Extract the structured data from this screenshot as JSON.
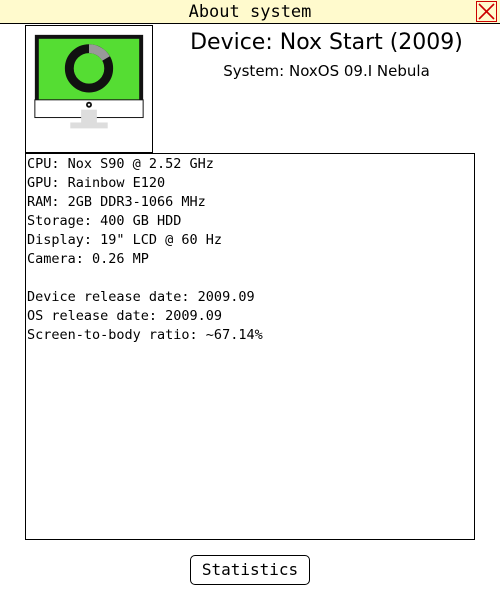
{
  "window": {
    "title": "About system",
    "close_icon": "close-icon"
  },
  "device": {
    "title": "Device: Nox Start (2009)",
    "system": "System: NoxOS 09.I Nebula",
    "image_icon": "computer-monitor-icon",
    "colors": {
      "screen_green": "#55dd33",
      "screen_frame": "#111111",
      "ring_dark": "#111111",
      "ring_segment": "#999999",
      "stand": "#dddddd"
    }
  },
  "specs": {
    "cpu": "CPU: Nox S90 @ 2.52 GHz",
    "gpu": "GPU: Rainbow E120",
    "ram": "RAM: 2GB DDR3-1066 MHz",
    "storage": "Storage: 400 GB HDD",
    "display": "Display: 19\" LCD @ 60 Hz",
    "camera": "Camera: 0.26 MP",
    "device_release": "Device release date: 2009.09",
    "os_release": "OS release date: 2009.09",
    "screen_ratio": "Screen-to-body ratio: ~67.14%"
  },
  "actions": {
    "statistics_label": "Statistics"
  },
  "colors": {
    "titlebar_bg": "#fffacd",
    "close_accent": "#cc0000"
  }
}
